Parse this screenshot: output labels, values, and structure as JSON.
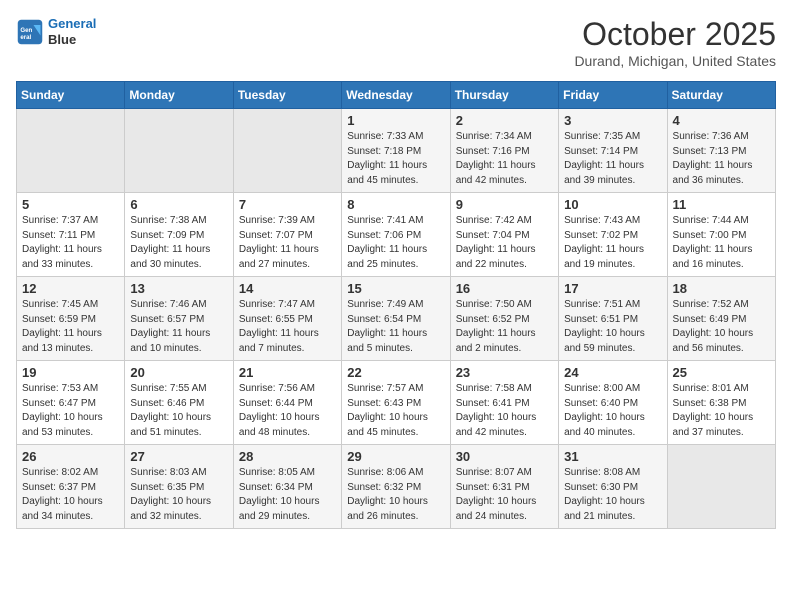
{
  "header": {
    "logo": {
      "line1": "General",
      "line2": "Blue"
    },
    "title": "October 2025",
    "location": "Durand, Michigan, United States"
  },
  "weekdays": [
    "Sunday",
    "Monday",
    "Tuesday",
    "Wednesday",
    "Thursday",
    "Friday",
    "Saturday"
  ],
  "weeks": [
    [
      {
        "day": "",
        "info": ""
      },
      {
        "day": "",
        "info": ""
      },
      {
        "day": "",
        "info": ""
      },
      {
        "day": "1",
        "info": "Sunrise: 7:33 AM\nSunset: 7:18 PM\nDaylight: 11 hours\nand 45 minutes."
      },
      {
        "day": "2",
        "info": "Sunrise: 7:34 AM\nSunset: 7:16 PM\nDaylight: 11 hours\nand 42 minutes."
      },
      {
        "day": "3",
        "info": "Sunrise: 7:35 AM\nSunset: 7:14 PM\nDaylight: 11 hours\nand 39 minutes."
      },
      {
        "day": "4",
        "info": "Sunrise: 7:36 AM\nSunset: 7:13 PM\nDaylight: 11 hours\nand 36 minutes."
      }
    ],
    [
      {
        "day": "5",
        "info": "Sunrise: 7:37 AM\nSunset: 7:11 PM\nDaylight: 11 hours\nand 33 minutes."
      },
      {
        "day": "6",
        "info": "Sunrise: 7:38 AM\nSunset: 7:09 PM\nDaylight: 11 hours\nand 30 minutes."
      },
      {
        "day": "7",
        "info": "Sunrise: 7:39 AM\nSunset: 7:07 PM\nDaylight: 11 hours\nand 27 minutes."
      },
      {
        "day": "8",
        "info": "Sunrise: 7:41 AM\nSunset: 7:06 PM\nDaylight: 11 hours\nand 25 minutes."
      },
      {
        "day": "9",
        "info": "Sunrise: 7:42 AM\nSunset: 7:04 PM\nDaylight: 11 hours\nand 22 minutes."
      },
      {
        "day": "10",
        "info": "Sunrise: 7:43 AM\nSunset: 7:02 PM\nDaylight: 11 hours\nand 19 minutes."
      },
      {
        "day": "11",
        "info": "Sunrise: 7:44 AM\nSunset: 7:00 PM\nDaylight: 11 hours\nand 16 minutes."
      }
    ],
    [
      {
        "day": "12",
        "info": "Sunrise: 7:45 AM\nSunset: 6:59 PM\nDaylight: 11 hours\nand 13 minutes."
      },
      {
        "day": "13",
        "info": "Sunrise: 7:46 AM\nSunset: 6:57 PM\nDaylight: 11 hours\nand 10 minutes."
      },
      {
        "day": "14",
        "info": "Sunrise: 7:47 AM\nSunset: 6:55 PM\nDaylight: 11 hours\nand 7 minutes."
      },
      {
        "day": "15",
        "info": "Sunrise: 7:49 AM\nSunset: 6:54 PM\nDaylight: 11 hours\nand 5 minutes."
      },
      {
        "day": "16",
        "info": "Sunrise: 7:50 AM\nSunset: 6:52 PM\nDaylight: 11 hours\nand 2 minutes."
      },
      {
        "day": "17",
        "info": "Sunrise: 7:51 AM\nSunset: 6:51 PM\nDaylight: 10 hours\nand 59 minutes."
      },
      {
        "day": "18",
        "info": "Sunrise: 7:52 AM\nSunset: 6:49 PM\nDaylight: 10 hours\nand 56 minutes."
      }
    ],
    [
      {
        "day": "19",
        "info": "Sunrise: 7:53 AM\nSunset: 6:47 PM\nDaylight: 10 hours\nand 53 minutes."
      },
      {
        "day": "20",
        "info": "Sunrise: 7:55 AM\nSunset: 6:46 PM\nDaylight: 10 hours\nand 51 minutes."
      },
      {
        "day": "21",
        "info": "Sunrise: 7:56 AM\nSunset: 6:44 PM\nDaylight: 10 hours\nand 48 minutes."
      },
      {
        "day": "22",
        "info": "Sunrise: 7:57 AM\nSunset: 6:43 PM\nDaylight: 10 hours\nand 45 minutes."
      },
      {
        "day": "23",
        "info": "Sunrise: 7:58 AM\nSunset: 6:41 PM\nDaylight: 10 hours\nand 42 minutes."
      },
      {
        "day": "24",
        "info": "Sunrise: 8:00 AM\nSunset: 6:40 PM\nDaylight: 10 hours\nand 40 minutes."
      },
      {
        "day": "25",
        "info": "Sunrise: 8:01 AM\nSunset: 6:38 PM\nDaylight: 10 hours\nand 37 minutes."
      }
    ],
    [
      {
        "day": "26",
        "info": "Sunrise: 8:02 AM\nSunset: 6:37 PM\nDaylight: 10 hours\nand 34 minutes."
      },
      {
        "day": "27",
        "info": "Sunrise: 8:03 AM\nSunset: 6:35 PM\nDaylight: 10 hours\nand 32 minutes."
      },
      {
        "day": "28",
        "info": "Sunrise: 8:05 AM\nSunset: 6:34 PM\nDaylight: 10 hours\nand 29 minutes."
      },
      {
        "day": "29",
        "info": "Sunrise: 8:06 AM\nSunset: 6:32 PM\nDaylight: 10 hours\nand 26 minutes."
      },
      {
        "day": "30",
        "info": "Sunrise: 8:07 AM\nSunset: 6:31 PM\nDaylight: 10 hours\nand 24 minutes."
      },
      {
        "day": "31",
        "info": "Sunrise: 8:08 AM\nSunset: 6:30 PM\nDaylight: 10 hours\nand 21 minutes."
      },
      {
        "day": "",
        "info": ""
      }
    ]
  ]
}
